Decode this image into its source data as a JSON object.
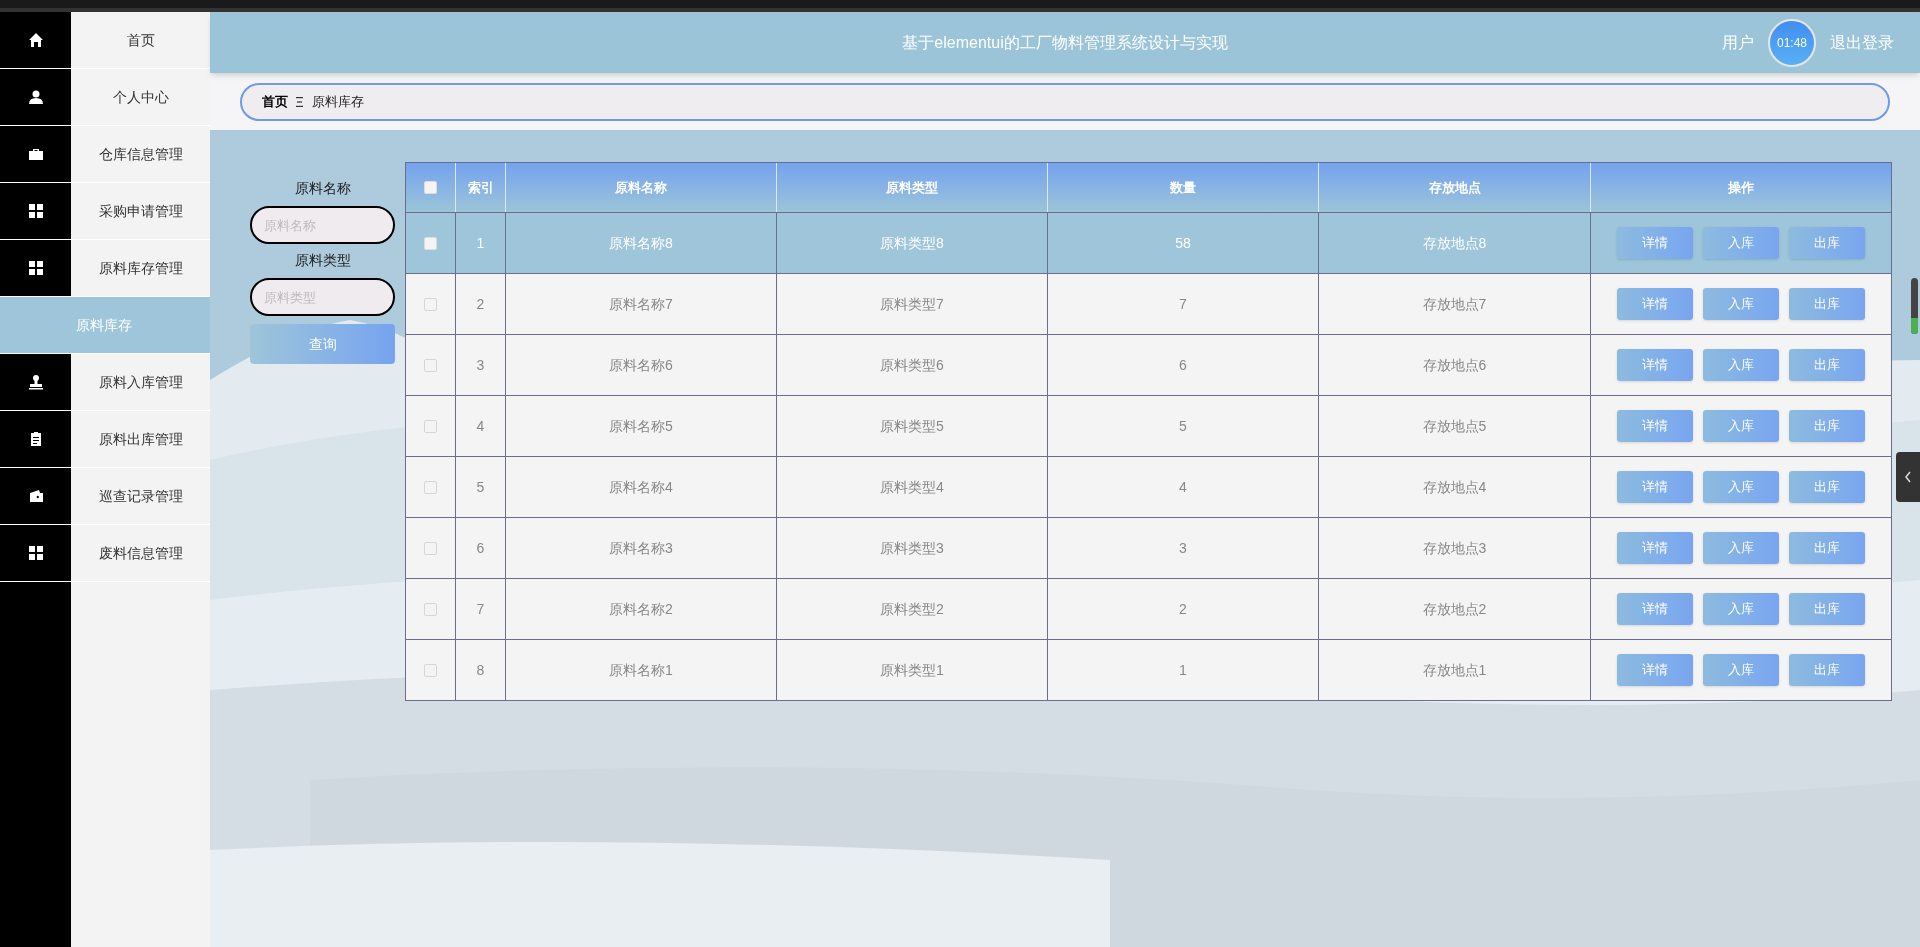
{
  "sidebar": {
    "items": [
      {
        "label": "首页",
        "kind": "menu",
        "selected": false
      },
      {
        "label": "个人中心",
        "kind": "menu",
        "selected": false
      },
      {
        "label": "仓库信息管理",
        "kind": "menu",
        "selected": false
      },
      {
        "label": "采购申请管理",
        "kind": "menu",
        "selected": false
      },
      {
        "label": "原料库存管理",
        "kind": "menu",
        "selected": false
      },
      {
        "label": "原料库存",
        "kind": "submenu",
        "selected": true
      },
      {
        "label": "原料入库管理",
        "kind": "menu",
        "selected": false
      },
      {
        "label": "原料出库管理",
        "kind": "menu",
        "selected": false
      },
      {
        "label": "巡查记录管理",
        "kind": "menu",
        "selected": false
      },
      {
        "label": "废料信息管理",
        "kind": "menu",
        "selected": false
      }
    ]
  },
  "header": {
    "title": "基于elementui的工厂物料管理系统设计与实现",
    "user": "用户",
    "logout": "退出登录",
    "timer": "01:48"
  },
  "breadcrumb": [
    "首页",
    "原料库存"
  ],
  "search": {
    "fields": [
      {
        "label": "原料名称",
        "placeholder": "原料名称"
      },
      {
        "label": "原料类型",
        "placeholder": "原料类型"
      }
    ],
    "button": "查询"
  },
  "table": {
    "columns": [
      "索引",
      "原料名称",
      "原料类型",
      "数量",
      "存放地点",
      "操作"
    ],
    "header_checked": false,
    "rows": [
      {
        "cells": [
          "1",
          "原料名称8",
          "原料类型8",
          "58",
          "存放地点8"
        ],
        "actions": [
          "详情",
          "入库",
          "出库"
        ],
        "selected": true,
        "checked": false
      },
      {
        "cells": [
          "2",
          "原料名称7",
          "原料类型7",
          "7",
          "存放地点7"
        ],
        "actions": [
          "详情",
          "入库",
          "出库"
        ],
        "selected": false,
        "checked": false
      },
      {
        "cells": [
          "3",
          "原料名称6",
          "原料类型6",
          "6",
          "存放地点6"
        ],
        "actions": [
          "详情",
          "入库",
          "出库"
        ],
        "selected": false,
        "checked": false
      },
      {
        "cells": [
          "4",
          "原料名称5",
          "原料类型5",
          "5",
          "存放地点5"
        ],
        "actions": [
          "详情",
          "入库",
          "出库"
        ],
        "selected": false,
        "checked": false
      },
      {
        "cells": [
          "5",
          "原料名称4",
          "原料类型4",
          "4",
          "存放地点4"
        ],
        "actions": [
          "详情",
          "入库",
          "出库"
        ],
        "selected": false,
        "checked": false
      },
      {
        "cells": [
          "6",
          "原料名称3",
          "原料类型3",
          "3",
          "存放地点3"
        ],
        "actions": [
          "详情",
          "入库",
          "出库"
        ],
        "selected": false,
        "checked": false
      },
      {
        "cells": [
          "7",
          "原料名称2",
          "原料类型2",
          "2",
          "存放地点2"
        ],
        "actions": [
          "详情",
          "入库",
          "出库"
        ],
        "selected": false,
        "checked": false
      },
      {
        "cells": [
          "8",
          "原料名称1",
          "原料类型1",
          "1",
          "存放地点1"
        ],
        "actions": [
          "详情",
          "入库",
          "出库"
        ],
        "selected": false,
        "checked": false
      }
    ]
  }
}
